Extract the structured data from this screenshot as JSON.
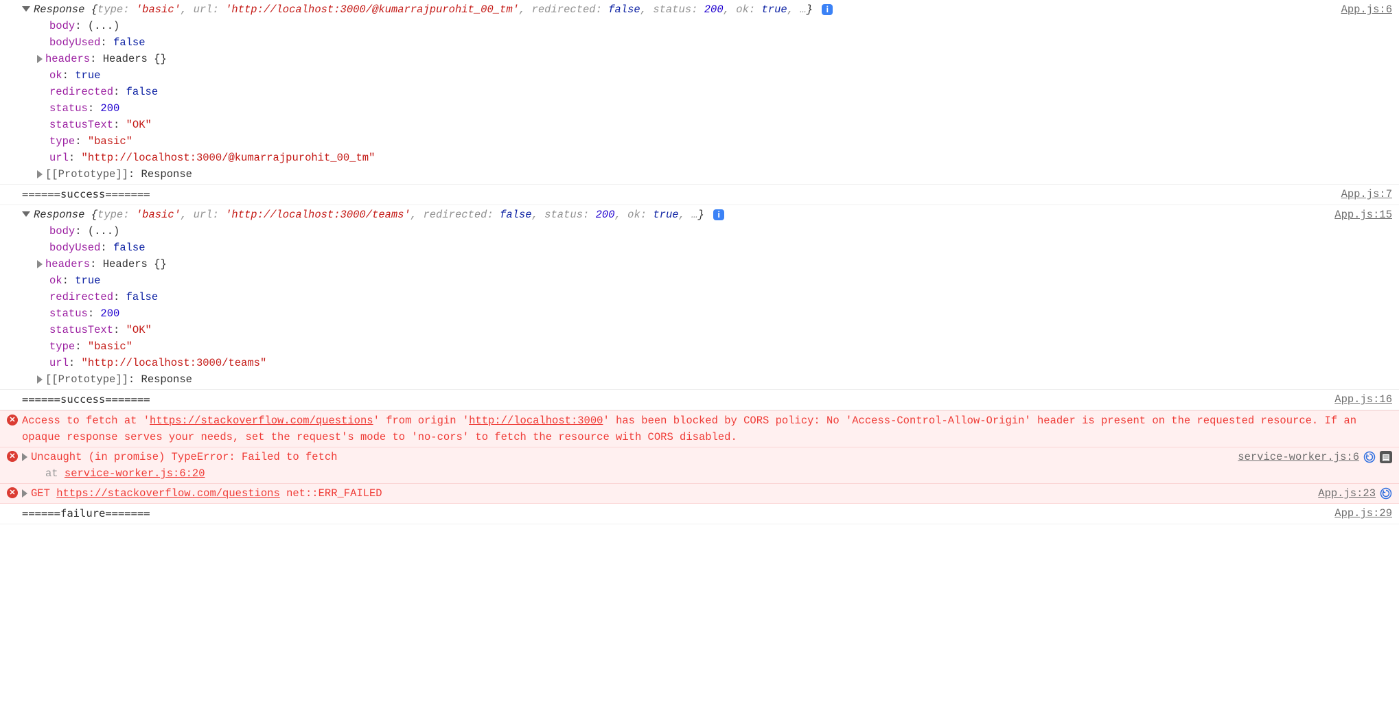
{
  "entries": [
    {
      "kind": "object",
      "src": "App.js:6",
      "className": "Response",
      "summary": {
        "type": "'basic'",
        "url": "'http://localhost:3000/@kumarrajpurohit_00_tm'",
        "redirected": "false",
        "status": "200",
        "ok": "true"
      },
      "props": [
        {
          "key": "body",
          "display": "(...)",
          "type": "plain"
        },
        {
          "key": "bodyUsed",
          "display": "false",
          "type": "bool"
        },
        {
          "key": "headers",
          "display": "Headers {}",
          "type": "obj",
          "expandable": true
        },
        {
          "key": "ok",
          "display": "true",
          "type": "bool"
        },
        {
          "key": "redirected",
          "display": "false",
          "type": "bool"
        },
        {
          "key": "status",
          "display": "200",
          "type": "num"
        },
        {
          "key": "statusText",
          "display": "\"OK\"",
          "type": "str"
        },
        {
          "key": "type",
          "display": "\"basic\"",
          "type": "str"
        },
        {
          "key": "url",
          "display": "\"http://localhost:3000/@kumarrajpurohit_00_tm\"",
          "type": "str"
        },
        {
          "key": "[[Prototype]]",
          "display": "Response",
          "type": "proto",
          "expandable": true
        }
      ]
    },
    {
      "kind": "log",
      "text": "======success=======",
      "src": "App.js:7"
    },
    {
      "kind": "object",
      "src": "App.js:15",
      "className": "Response",
      "summary": {
        "type": "'basic'",
        "url": "'http://localhost:3000/teams'",
        "redirected": "false",
        "status": "200",
        "ok": "true"
      },
      "props": [
        {
          "key": "body",
          "display": "(...)",
          "type": "plain"
        },
        {
          "key": "bodyUsed",
          "display": "false",
          "type": "bool"
        },
        {
          "key": "headers",
          "display": "Headers {}",
          "type": "obj",
          "expandable": true
        },
        {
          "key": "ok",
          "display": "true",
          "type": "bool"
        },
        {
          "key": "redirected",
          "display": "false",
          "type": "bool"
        },
        {
          "key": "status",
          "display": "200",
          "type": "num"
        },
        {
          "key": "statusText",
          "display": "\"OK\"",
          "type": "str"
        },
        {
          "key": "type",
          "display": "\"basic\"",
          "type": "str"
        },
        {
          "key": "url",
          "display": "\"http://localhost:3000/teams\"",
          "type": "str"
        },
        {
          "key": "[[Prototype]]",
          "display": "Response",
          "type": "proto",
          "expandable": true
        }
      ]
    },
    {
      "kind": "log",
      "text": "======success=======",
      "src": "App.js:16"
    },
    {
      "kind": "error",
      "src": "",
      "parts": [
        {
          "t": "text",
          "v": "Access to fetch at '"
        },
        {
          "t": "link",
          "v": "https://stackoverflow.com/questions"
        },
        {
          "t": "text",
          "v": "' from origin '"
        },
        {
          "t": "link",
          "v": "http://localhost:3000"
        },
        {
          "t": "text",
          "v": "' has been blocked by CORS policy: No 'Access-Control-Allow-Origin' header is present on the requested resource. If an opaque response serves your needs, set the request's mode to 'no-cors' to fetch the resource with CORS disabled."
        }
      ]
    },
    {
      "kind": "error",
      "src": "service-worker.js:6",
      "srcExtra": [
        "reload",
        "issue"
      ],
      "expandable": true,
      "parts": [
        {
          "t": "text",
          "v": "Uncaught (in promise) TypeError: Failed to fetch"
        }
      ],
      "stack": [
        {
          "prefix": "at ",
          "link": "service-worker.js:6:20"
        }
      ]
    },
    {
      "kind": "error",
      "src": "App.js:23",
      "srcExtra": [
        "reload"
      ],
      "expandable": true,
      "parts": [
        {
          "t": "text",
          "v": "GET "
        },
        {
          "t": "link",
          "v": "https://stackoverflow.com/questions"
        },
        {
          "t": "text",
          "v": " net::ERR_FAILED"
        }
      ]
    },
    {
      "kind": "log",
      "text": "======failure=======",
      "src": "App.js:29"
    }
  ],
  "glyphs": {
    "info": "i",
    "issue": "⁘",
    "error": "✕"
  }
}
